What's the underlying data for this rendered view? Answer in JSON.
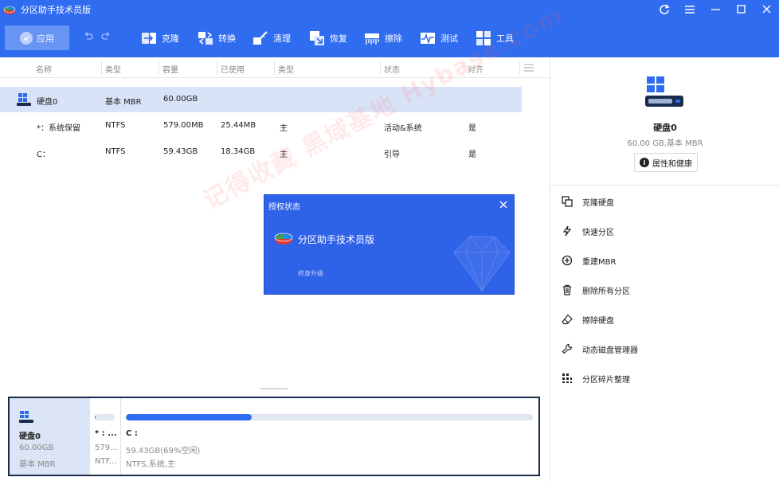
{
  "window": {
    "title": "分区助手技术员版"
  },
  "toolbar": {
    "apply_label": "应用",
    "tools": [
      {
        "name": "clone",
        "icon": "clone-icon",
        "label": "克隆"
      },
      {
        "name": "convert",
        "icon": "convert-icon",
        "label": "转换"
      },
      {
        "name": "clean",
        "icon": "clean-icon",
        "label": "清理"
      },
      {
        "name": "restore",
        "icon": "restore-icon",
        "label": "恢复"
      },
      {
        "name": "wipe",
        "icon": "wipe-icon",
        "label": "擦除"
      },
      {
        "name": "test",
        "icon": "test-icon",
        "label": "测试"
      },
      {
        "name": "tools",
        "icon": "tools-icon",
        "label": "工具"
      }
    ]
  },
  "table": {
    "headers": [
      "名称",
      "类型",
      "容量",
      "已使用",
      "类型",
      "状态",
      "对齐"
    ],
    "rows": [
      {
        "name": "硬盘0",
        "type": "基本 MBR",
        "capacity": "60.00GB",
        "used": "",
        "kind": "",
        "status": "",
        "align": ""
      },
      {
        "name": "*：系统保留",
        "type": "NTFS",
        "capacity": "579.00MB",
        "used": "25.44MB",
        "kind": "主",
        "status": "活动&系统",
        "align": "是"
      },
      {
        "name": "C：",
        "type": "NTFS",
        "capacity": "59.43GB",
        "used": "18.34GB",
        "kind": "主",
        "status": "引导",
        "align": "是"
      }
    ]
  },
  "dialog": {
    "title": "授权状态",
    "app_name": "分区助手技术员版",
    "link": "终身升级"
  },
  "watermark": "记得收藏 黑域基地 Hybase.com",
  "disk_map": {
    "disk": {
      "name": "硬盘0",
      "capacity": "60.00GB",
      "type": "基本 MBR"
    },
    "partitions": [
      {
        "name": "* : ...",
        "capacity": "579...",
        "type": "NTF...",
        "used_fraction": 0.044
      },
      {
        "name": "C :",
        "capacity": "59.43GB(69%空闲)",
        "type": "NTFS,系统,主",
        "used_fraction": 0.31
      }
    ]
  },
  "right_panel": {
    "disk_name": "硬盘0",
    "disk_info": "60.00 GB,基本 MBR",
    "props_button": "属性和健康",
    "actions": [
      {
        "icon": "clone-disk-icon",
        "label": "克隆硬盘"
      },
      {
        "icon": "quick-partition-icon",
        "label": "快速分区"
      },
      {
        "icon": "rebuild-mbr-icon",
        "label": "重建MBR"
      },
      {
        "icon": "delete-all-partitions-icon",
        "label": "删除所有分区"
      },
      {
        "icon": "wipe-disk-icon",
        "label": "擦除硬盘"
      },
      {
        "icon": "dynamic-disk-icon",
        "label": "动态磁盘管理器"
      },
      {
        "icon": "defrag-icon",
        "label": "分区碎片整理"
      }
    ]
  },
  "colors": {
    "accent": "#2f6cf0",
    "selected_row": "#d9e3f7",
    "dialog_bg": "#2e62e8"
  }
}
